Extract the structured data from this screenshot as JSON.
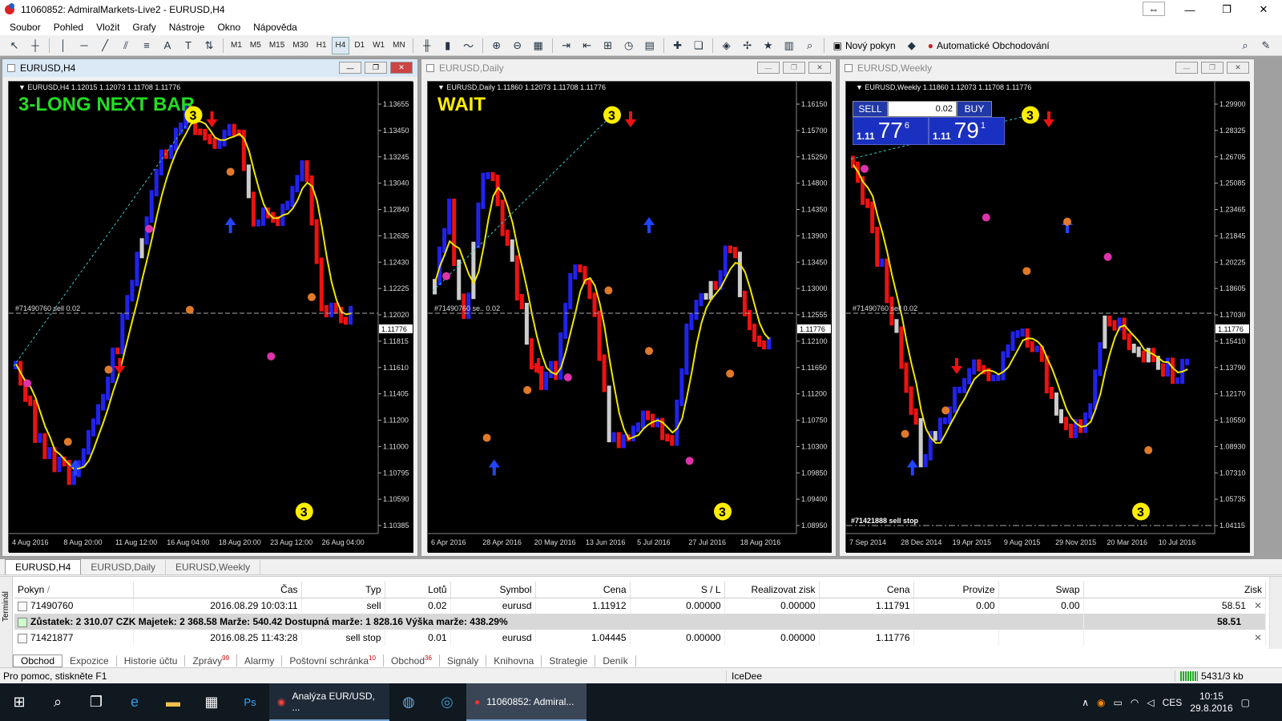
{
  "window": {
    "title": "11060852: AdmiralMarkets-Live2 - EURUSD,H4"
  },
  "menu": [
    "Soubor",
    "Pohled",
    "Vložit",
    "Grafy",
    "Nástroje",
    "Okno",
    "Nápověda"
  ],
  "toolbar": {
    "timeframes": [
      "M1",
      "M5",
      "M15",
      "M30",
      "H1",
      "H4",
      "D1",
      "W1",
      "MN"
    ],
    "active_timeframe": "H4",
    "new_order_label": "Nový pokyn",
    "auto_trading_label": "Automatické Obchodování"
  },
  "charts": [
    {
      "window_title": "EURUSD,H4",
      "info": "EURUSD,H4  1.12015 1.12073 1.11708 1.11776",
      "overlay_text": "3-LONG NEXT BAR",
      "overlay_color": "#22dd22",
      "order_label": "#71490760 sell 0.02",
      "current_price": "1.11776",
      "price_labels": [
        "1.13655",
        "1.13450",
        "1.13245",
        "1.13040",
        "1.12840",
        "1.12635",
        "1.12430",
        "1.12225",
        "1.12020",
        "1.11815",
        "1.11610",
        "1.11405",
        "1.11200",
        "1.11000",
        "1.10795",
        "1.10590",
        "1.10385"
      ],
      "date_labels": [
        "4 Aug 2016",
        "8 Aug 20:00",
        "11 Aug 12:00",
        "16 Aug 04:00",
        "18 Aug 20:00",
        "23 Aug 12:00",
        "26 Aug 04:00"
      ]
    },
    {
      "window_title": "EURUSD,Daily",
      "info": "EURUSD,Daily  1.11860 1.12073 1.11708 1.11776",
      "overlay_text": "WAIT",
      "overlay_color": "#ffee00",
      "order_label": "#71490760 se.. 0.02",
      "current_price": "1.11776",
      "price_labels": [
        "1.16150",
        "1.15700",
        "1.15250",
        "1.14800",
        "1.14350",
        "1.13900",
        "1.13450",
        "1.13000",
        "1.12555",
        "1.12100",
        "1.11650",
        "1.11200",
        "1.10750",
        "1.10300",
        "1.09850",
        "1.09400",
        "1.08950"
      ],
      "date_labels": [
        "6 Apr 2016",
        "28 Apr 2016",
        "20 May 2016",
        "13 Jun 2016",
        "5 Jul 2016",
        "27 Jul 2016",
        "18 Aug 2016"
      ]
    },
    {
      "window_title": "EURUSD,Weekly",
      "info": "EURUSD,Weekly  1.11860 1.12073 1.11708 1.11776",
      "overlay_text": "",
      "overlay_color": "",
      "order_label": "#71490760 sell 0.02",
      "stop_label": "#71421888 sell stop",
      "current_price": "1.11776",
      "price_labels": [
        "1.29900",
        "1.28325",
        "1.26705",
        "1.25085",
        "1.23465",
        "1.21845",
        "1.20225",
        "1.18605",
        "1.17030",
        "1.15410",
        "1.13790",
        "1.12170",
        "1.10550",
        "1.08930",
        "1.07310",
        "1.05735",
        "1.04115"
      ],
      "date_labels": [
        "7 Sep 2014",
        "28 Dec 2014",
        "19 Apr 2015",
        "9 Aug 2015",
        "29 Nov 2015",
        "20 Mar 2016",
        "10 Jul 2016"
      ],
      "trade_panel": {
        "sell": "SELL",
        "buy": "BUY",
        "lot": "0.02",
        "sell_small": "1.11",
        "sell_big": "77",
        "sell_sup": "6",
        "buy_small": "1.11",
        "buy_big": "79",
        "buy_sup": "1"
      }
    }
  ],
  "chart_tabs": [
    "EURUSD,H4",
    "EURUSD,Daily",
    "EURUSD,Weekly"
  ],
  "terminal": {
    "side_label": "Terminál",
    "columns": [
      "Pokyn",
      "/",
      "Čas",
      "Typ",
      "Lotů",
      "Symbol",
      "Cena",
      "S / L",
      "Realizovat zisk",
      "Cena",
      "Provize",
      "Swap",
      "Zisk"
    ],
    "rows": [
      {
        "order": "71490760",
        "time": "2016.08.29 10:03:11",
        "type": "sell",
        "lots": "0.02",
        "symbol": "eurusd",
        "price": "1.11912",
        "sl": "0.00000",
        "tp": "0.00000",
        "cur": "1.11791",
        "comm": "0.00",
        "swap": "0.00",
        "profit": "58.51"
      }
    ],
    "summary": {
      "text": "Zůstatek: 2 310.07 CZK  Majetek: 2 368.58  Marže: 540.42  Dostupná marže: 1 828.16  Výška marže: 438.29%",
      "profit": "58.51"
    },
    "pending": {
      "order": "71421877",
      "time": "2016.08.25 11:43:28",
      "type": "sell stop",
      "lots": "0.01",
      "symbol": "eurusd",
      "price": "1.04445",
      "sl": "0.00000",
      "tp": "0.00000",
      "cur": "1.11776"
    },
    "tabs": [
      {
        "label": "Obchod",
        "count": ""
      },
      {
        "label": "Expozice",
        "count": ""
      },
      {
        "label": "Historie účtu",
        "count": ""
      },
      {
        "label": "Zprávy",
        "count": "99"
      },
      {
        "label": "Alarmy",
        "count": ""
      },
      {
        "label": "Poštovní schránka",
        "count": "10"
      },
      {
        "label": "Obchod",
        "count": "36"
      },
      {
        "label": "Signály",
        "count": ""
      },
      {
        "label": "Knihovna",
        "count": ""
      },
      {
        "label": "Strategie",
        "count": ""
      },
      {
        "label": "Deník",
        "count": ""
      }
    ]
  },
  "status": {
    "help": "Pro pomoc, stiskněte F1",
    "profile": "IceDee",
    "traffic": "5431/3 kb"
  },
  "taskbar": {
    "app1": "Analýza EUR/USD, ...",
    "app2": "11060852: Admiral...",
    "lang": "CES",
    "time": "10:15",
    "date": "29.8.2016"
  }
}
